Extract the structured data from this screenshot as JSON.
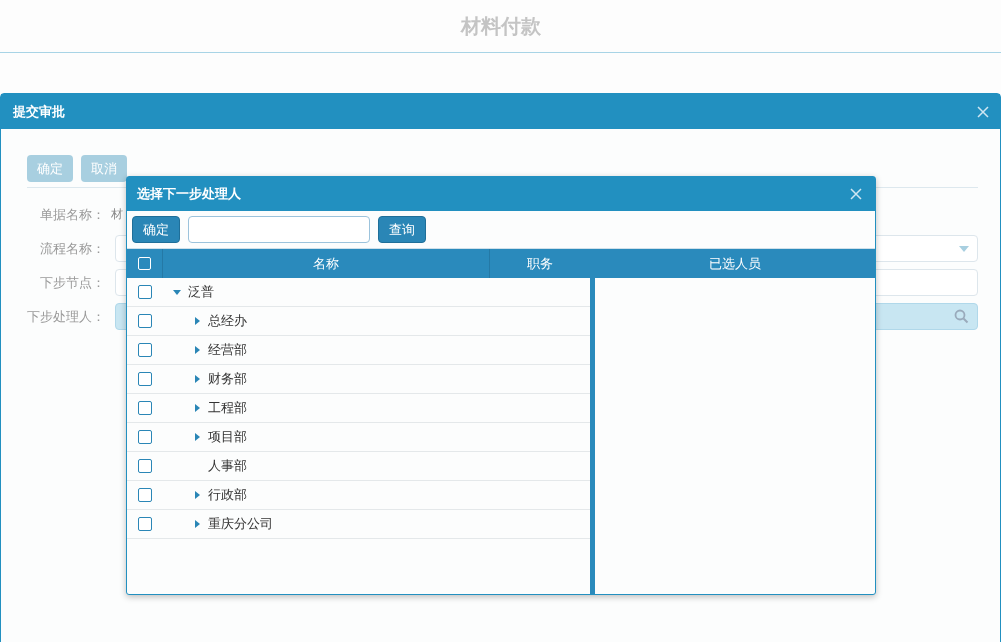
{
  "page": {
    "title": "材料付款"
  },
  "dialog": {
    "title": "提交审批",
    "buttons": [
      {
        "label": "确定"
      },
      {
        "label": "取消"
      }
    ],
    "fields": [
      {
        "label": "单据名称：",
        "kind": "text",
        "value": "材"
      },
      {
        "label": "流程名称：",
        "kind": "select"
      },
      {
        "label": "下步节点：",
        "kind": "input"
      },
      {
        "label": "下步处理人：",
        "kind": "lookup"
      }
    ]
  },
  "picker": {
    "title": "选择下一步处理人",
    "confirm": "确定",
    "search_button": "查询",
    "columns": [
      "名称",
      "职务"
    ],
    "all_checked": false,
    "selected_header": "已选人员",
    "tree": [
      {
        "name": "泛普",
        "checked": false,
        "kind": "branch",
        "expanded": true,
        "children": [
          {
            "name": "总经办",
            "checked": false,
            "kind": "branch",
            "expanded": false
          },
          {
            "name": "经营部",
            "checked": false,
            "kind": "branch",
            "expanded": false
          },
          {
            "name": "财务部",
            "checked": false,
            "kind": "branch",
            "expanded": false
          },
          {
            "name": "工程部",
            "checked": false,
            "kind": "branch",
            "expanded": false
          },
          {
            "name": "项目部",
            "checked": false,
            "kind": "branch",
            "expanded": false
          },
          {
            "name": "人事部",
            "checked": false,
            "kind": "leaf"
          },
          {
            "name": "行政部",
            "checked": false,
            "kind": "branch",
            "expanded": false
          },
          {
            "name": "重庆分公司",
            "checked": false,
            "kind": "branch",
            "expanded": false
          }
        ]
      }
    ]
  }
}
